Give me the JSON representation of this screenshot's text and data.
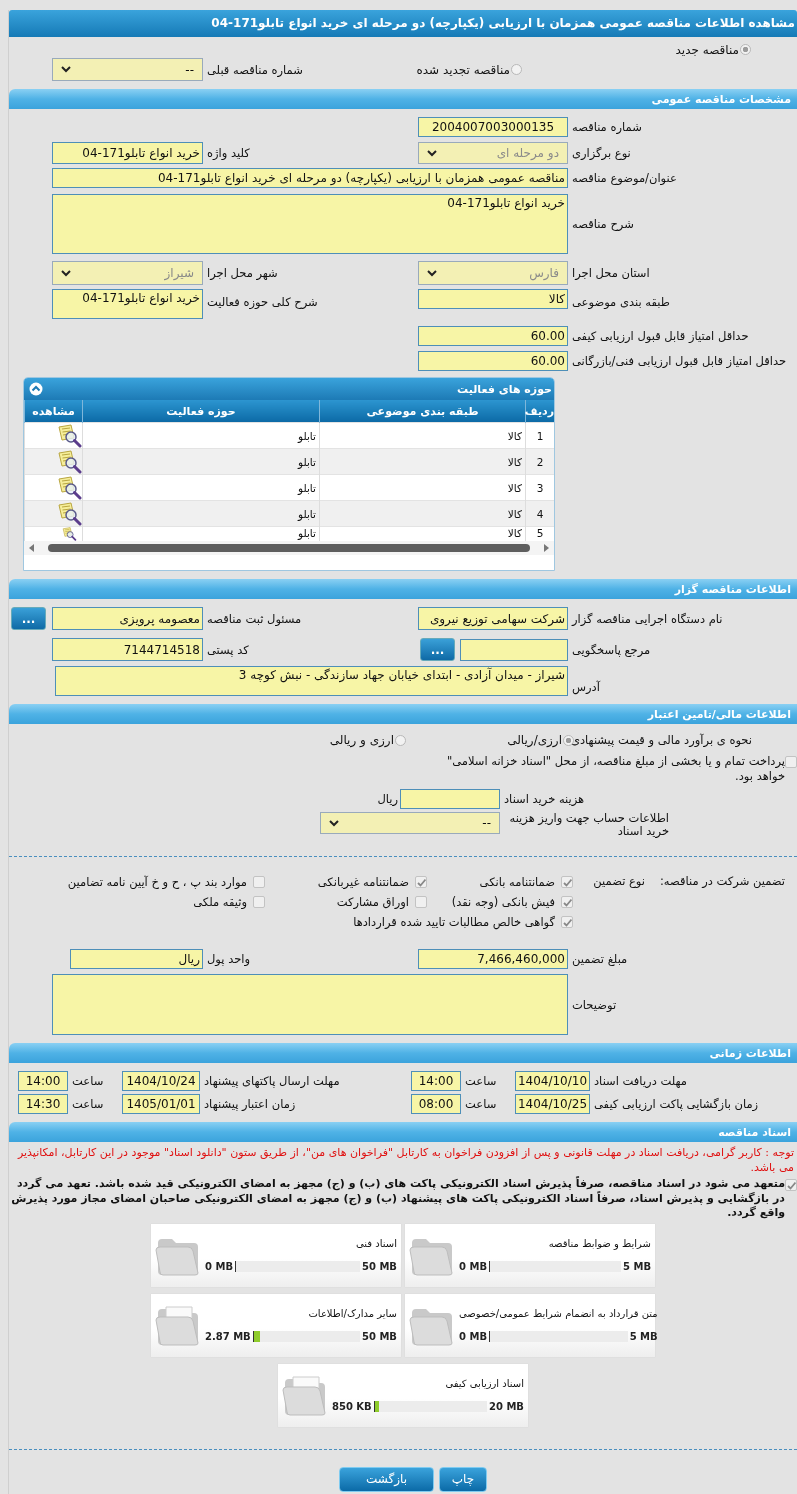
{
  "title": "مشاهده اطلاعات مناقصه عمومی همزمان با ارزیابی (یکپارچه) دو مرحله ای خرید انواع تابلو171-04",
  "tender_kind": [
    {
      "label": "مناقصه جدید",
      "selected": true
    },
    {
      "label": "مناقصه تجدید شده",
      "selected": false
    }
  ],
  "previous_tender": {
    "label": "شماره مناقصه قبلی",
    "value": "--"
  },
  "general": {
    "heading": "مشخصات مناقصه عمومی",
    "tender_number": {
      "label": "شماره مناقصه",
      "value": "2004007003000135"
    },
    "holding_type": {
      "label": "نوع برگزاری",
      "value": "دو مرحله ای",
      "disabled": true
    },
    "keyword": {
      "label": "کلید واژه",
      "value": "خرید انواع تابلو171-04"
    },
    "subject": {
      "label": "عنوان/موضوع مناقصه",
      "value": "مناقصه عمومی همزمان با ارزیابی (یکپارچه) دو مرحله ای خرید انواع تابلو171-04"
    },
    "description": {
      "label": "شرح مناقصه",
      "value": "خرید انواع تابلو171-04"
    },
    "province": {
      "label": "استان محل اجرا",
      "value": "فارس",
      "disabled": true
    },
    "city": {
      "label": "شهر محل اجرا",
      "value": "شیراز",
      "disabled": true
    },
    "category": {
      "label": "طبقه بندی موضوعی",
      "value": "کالا"
    },
    "activity_description": {
      "label": "شرح کلی حوزه فعالیت",
      "value": "خرید انواع تابلو171-04"
    },
    "min_quality_score": {
      "label": "حداقل امتیاز قابل قبول ارزیابی کیفی",
      "value": "60.00"
    },
    "min_technical_score": {
      "label": "حداقل امتیاز قابل قبول ارزیابی فنی/بازرگانی",
      "value": "60.00"
    }
  },
  "activities": {
    "title": "حوزه های فعالیت",
    "columns": [
      "ردیف",
      "طبقه بندی موضوعی",
      "حوزه فعالیت",
      "مشاهده"
    ],
    "rows": [
      {
        "row": "1",
        "category": "کالا",
        "activity": "تابلو"
      },
      {
        "row": "2",
        "category": "کالا",
        "activity": "تابلو"
      },
      {
        "row": "3",
        "category": "کالا",
        "activity": "تابلو"
      },
      {
        "row": "4",
        "category": "کالا",
        "activity": "تابلو"
      },
      {
        "row": "5",
        "category": "کالا",
        "activity": "تابلو"
      }
    ]
  },
  "organizer": {
    "heading": "اطلاعات مناقصه گزار",
    "executive_body": {
      "label": "نام دستگاه اجرایی مناقصه گزار",
      "value": "شرکت سهامی توزیع نیروی"
    },
    "registrar": {
      "label": "مسئول ثبت مناقصه",
      "value": "معصومه پرویزی",
      "button": "..."
    },
    "responder": {
      "label": "مرجع پاسخگویی",
      "button": "..."
    },
    "postal_code": {
      "label": "کد پستی",
      "value": "7144714518"
    },
    "address": {
      "label": "آدرس",
      "value": "شیراز - میدان آزادی - ابتدای خیابان جهاد سازندگی - نبش کوچه 3"
    }
  },
  "finance": {
    "heading": "اطلاعات مالی/تامین اعتبار",
    "estimate": {
      "label": "نحوه ی برآورد مالی و قیمت پیشنهادی",
      "options": [
        {
          "label": "ارزی/ریالی",
          "selected": true
        },
        {
          "label": "ارزی و ریالی",
          "selected": false
        }
      ]
    },
    "treasury": {
      "text": "پرداخت تمام و یا بخشی از مبلغ مناقصه، از محل \"اسناد خزانه اسلامی\" خواهد بود.",
      "checked": false
    },
    "document_cost": {
      "label": "هزینه خرید اسناد",
      "unit": "ریال"
    },
    "account": {
      "label": "اطلاعات حساب جهت واریز هزینه خرید اسناد",
      "value": "--"
    }
  },
  "guarantee": {
    "label": "تضمین شرکت در مناقصه:",
    "type_label": "نوع تضمین",
    "options": [
      {
        "label": "ضمانتنامه بانکی",
        "checked": true
      },
      {
        "label": "ضمانتنامه غیربانکی",
        "checked": true
      },
      {
        "label": "موارد بند پ ، ح و خ آیین نامه تضامین",
        "checked": false
      },
      {
        "label": "فیش بانکی (وجه نقد)",
        "checked": true
      },
      {
        "label": "اوراق مشارکت",
        "checked": false
      },
      {
        "label": "وثیقه ملکی",
        "checked": false
      },
      {
        "label": "گواهی خالص مطالبات تایید شده قراردادها",
        "checked": true
      }
    ],
    "amount": {
      "label": "مبلغ تضمین",
      "value": "7,466,460,000"
    },
    "currency": {
      "label": "واحد پول",
      "value": "ریال"
    },
    "notes": {
      "label": "توضیحات"
    }
  },
  "timing": {
    "heading": "اطلاعات زمانی",
    "items": [
      {
        "label": "مهلت دریافت اسناد",
        "date": "1404/10/10",
        "time_label": "ساعت",
        "time": "14:00"
      },
      {
        "label": "مهلت ارسال پاکتهای پیشنهاد",
        "date": "1404/10/24",
        "time_label": "ساعت",
        "time": "14:00"
      },
      {
        "label": "زمان بازگشایی پاکت ارزیابی کیفی",
        "date": "1404/10/25",
        "time_label": "ساعت",
        "time": "08:00"
      },
      {
        "label": "زمان اعتبار پیشنهاد",
        "date": "1405/01/01",
        "time_label": "ساعت",
        "time": "14:30"
      }
    ]
  },
  "documents": {
    "heading": "اسناد مناقصه",
    "notice": "توجه : کاربر گرامی، دریافت اسناد در مهلت قانونی و پس از افزودن فراخوان به کارتابل \"فراخوان های من\"، از طریق ستون \"دانلود اسناد\" موجود در این کارتابل، امکانپذیر می باشد.",
    "commitment": {
      "text": "متعهد می شود در اسناد مناقصه، صرفاً پذیرش اسناد الکترونیکی پاکت های (ب) و (ج) مجهز به امضای الکترونیکی قید شده باشد. تعهد می گردد در بازگشایی و پذیرش اسناد، صرفاً اسناد الکترونیکی پاکت های پیشنهاد (ب) و (ج) مجهز به امضای الکترونیکی صاحبان امضای مجاز مورد پذیرش واقع گردد.",
      "checked": true
    },
    "files": [
      {
        "title": "شرایط و ضوابط مناقصه",
        "used": "0 MB",
        "max": "5 MB",
        "level": 0
      },
      {
        "title": "اسناد فنی",
        "used": "0 MB",
        "max": "50 MB",
        "level": 0
      },
      {
        "title": "متن قرارداد به انضمام شرایط عمومی/خصوصی",
        "used": "0 MB",
        "max": "5 MB",
        "level": 0
      },
      {
        "title": "سایر مدارک/اطلاعات",
        "used": "2.87 MB",
        "max": "50 MB",
        "level": 0.06
      },
      {
        "title": "اسناد ارزیابی کیفی",
        "used": "850 KB",
        "max": "20 MB",
        "level": 0.04
      }
    ]
  },
  "buttons": [
    "چاپ",
    "بازگشت"
  ]
}
